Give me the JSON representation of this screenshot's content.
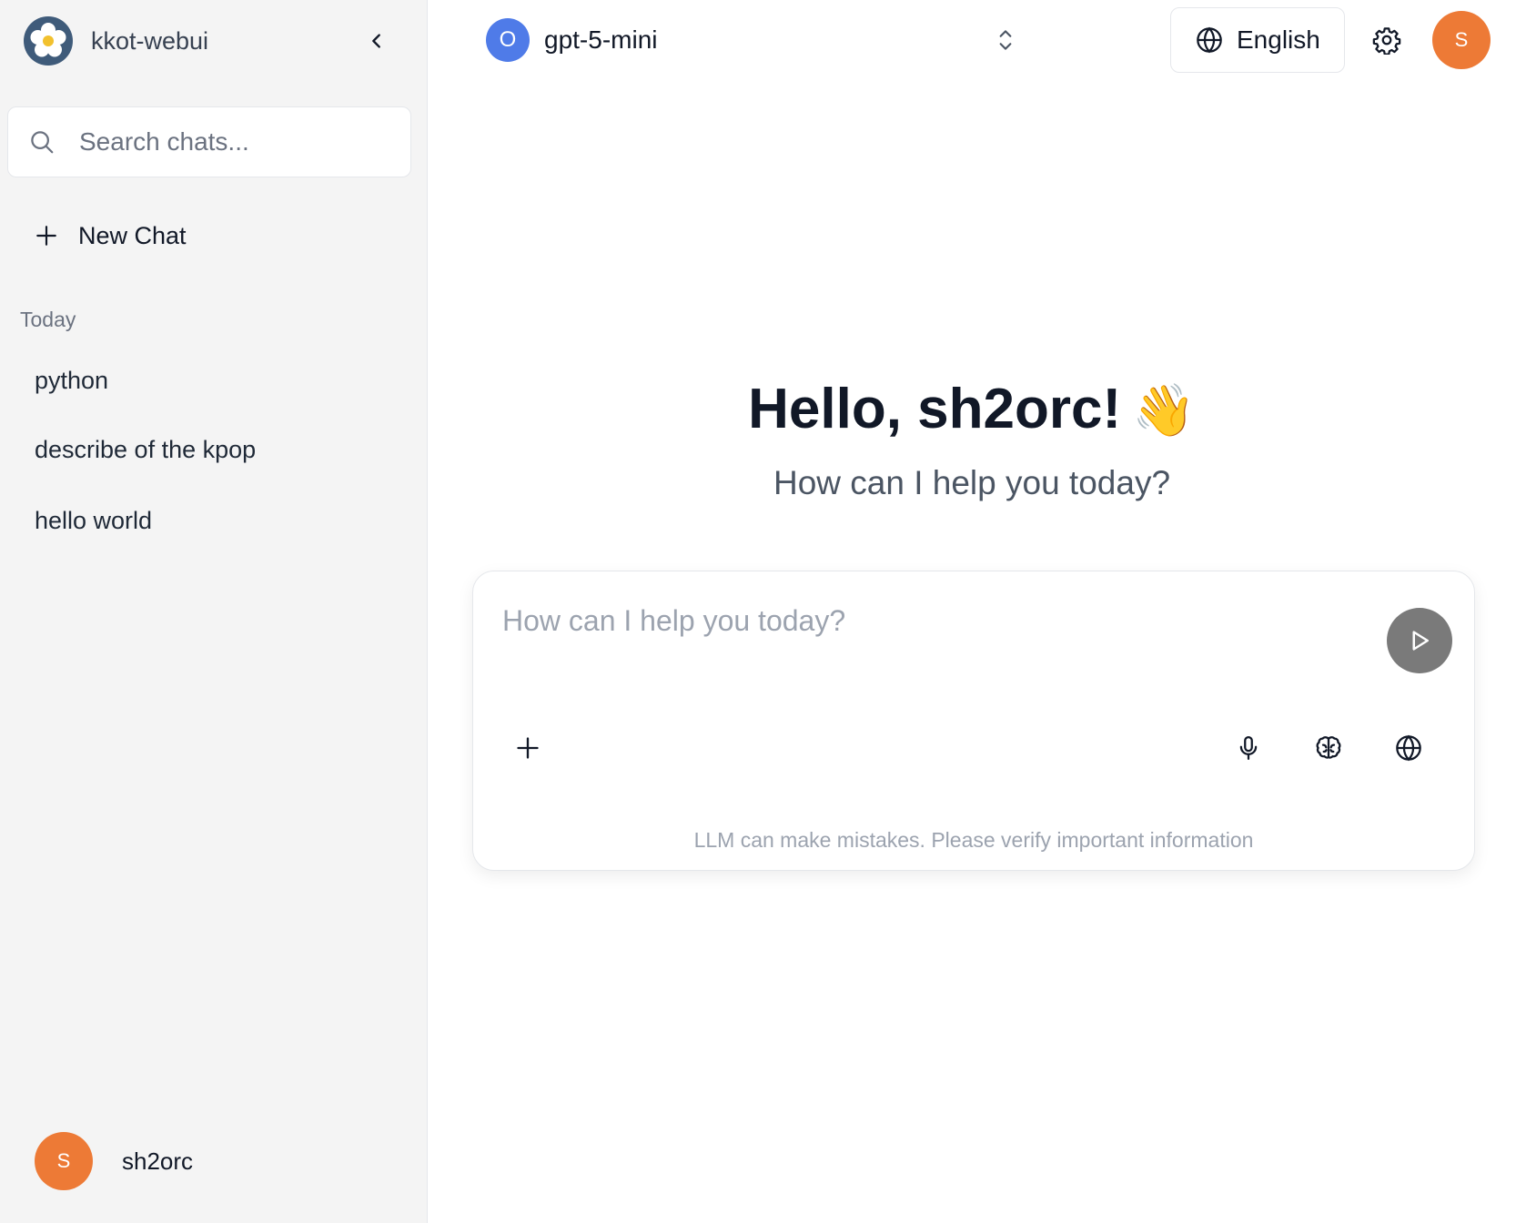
{
  "sidebar": {
    "app_name": "kkot-webui",
    "search": {
      "placeholder": "Search chats...",
      "value": ""
    },
    "new_chat_label": "New Chat",
    "section_label": "Today",
    "chats": [
      {
        "title": "python"
      },
      {
        "title": "describe of the kpop"
      },
      {
        "title": "hello world"
      }
    ],
    "user": {
      "initial": "S",
      "name": "sh2orc"
    }
  },
  "header": {
    "model": {
      "badge": "O",
      "name": "gpt-5-mini"
    },
    "language_label": "English",
    "avatar_initial": "S"
  },
  "main": {
    "greeting": "Hello, sh2orc!",
    "greeting_emoji": "👋",
    "subtitle": "How can I help you today?",
    "composer": {
      "placeholder": "How can I help you today?",
      "value": "",
      "disclaimer": "LLM can make mistakes. Please verify important information"
    }
  },
  "icons": {
    "logo": "flower-logo-icon",
    "collapse": "chevron-left-icon",
    "search": "search-icon",
    "new_chat": "plus-icon",
    "model_switch": "chevron-up-down-icon",
    "language": "globe-icon",
    "settings": "gear-icon",
    "send": "play-icon",
    "attach": "plus-icon",
    "voice": "microphone-icon",
    "reasoning": "brain-icon",
    "web_search": "globe-icon"
  },
  "colors": {
    "sidebar_bg": "#f4f4f4",
    "avatar": "#ed7a36",
    "model_badge": "#4f7be8",
    "send_button": "#7a7a7a",
    "logo_bg": "#3f5b7a"
  }
}
